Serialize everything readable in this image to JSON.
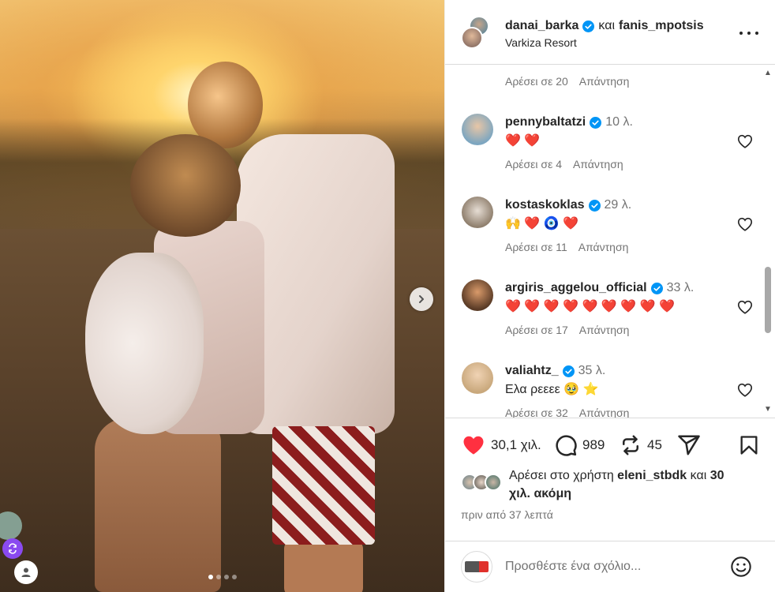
{
  "post": {
    "author": "danai_barka",
    "conjunction": "και",
    "coauthor": "fanis_mpotsis",
    "location": "Varkiza Resort"
  },
  "top_comment_meta": {
    "likes": "Αρέσει σε 20",
    "reply": "Απάντηση"
  },
  "comments": [
    {
      "user": "pennybaltatzi",
      "time": "10 λ.",
      "text": "❤️ ❤️",
      "likes": "Αρέσει σε 4",
      "reply": "Απάντηση"
    },
    {
      "user": "kostaskoklas",
      "time": "29 λ.",
      "text": "🙌 ❤️ 🧿 ❤️",
      "likes": "Αρέσει σε 11",
      "reply": "Απάντηση"
    },
    {
      "user": "argiris_aggelou_official",
      "time": "33 λ.",
      "text": "❤️ ❤️ ❤️ ❤️ ❤️ ❤️ ❤️ ❤️ ❤️",
      "likes": "Αρέσει σε 17",
      "reply": "Απάντηση"
    },
    {
      "user": "valiahtz_",
      "time": "35 λ.",
      "text": "Ελα ρεεεε 🥹 ⭐",
      "likes": "Αρέσει σε 32",
      "reply": "Απάντηση"
    }
  ],
  "actions": {
    "likes_count": "30,1 χιλ.",
    "comments_count": "989",
    "reposts_count": "45"
  },
  "liked_by": {
    "prefix": "Αρέσει στο χρήστη",
    "user": "eleni_stbdk",
    "middle": "και",
    "others": "30 χιλ. ακόμη"
  },
  "timestamp": "πριν από 37 λεπτά",
  "add_comment": {
    "placeholder": "Προσθέστε ένα σχόλιο..."
  },
  "carousel": {
    "total_slides": 4,
    "active_slide": 1
  },
  "colors": {
    "like_red": "#ff3040",
    "verified_blue": "#0095f6",
    "meta_gray": "#737373",
    "text": "#262626"
  },
  "icons": {
    "verified": "verified-badge-icon",
    "more": "more-options-icon",
    "heart": "heart-icon",
    "comment": "comment-icon",
    "repost": "repost-icon",
    "share": "share-icon",
    "save": "bookmark-icon",
    "emoji": "emoji-icon",
    "next": "chevron-right-icon"
  }
}
